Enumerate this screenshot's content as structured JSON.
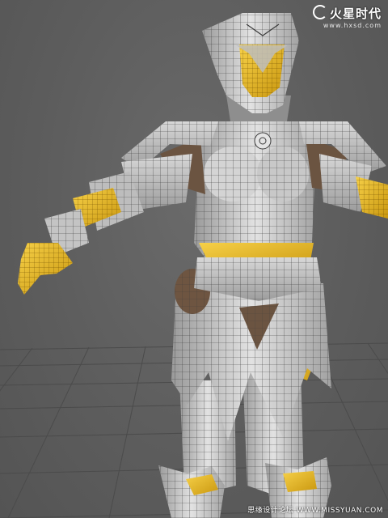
{
  "viewport": {
    "description_kind": "3D viewport render",
    "background_color": "#5f5f5f",
    "grid_color": "#4c4c4c"
  },
  "model": {
    "armor_color": "#c9c9c9",
    "wire_color": "#3a3a3a",
    "skin_color": "#e8b92a",
    "leather_color": "#6b5441"
  },
  "watermark_top": {
    "logo_text": "火星时代",
    "url": "www.hxsd.com"
  },
  "watermark_bottom": {
    "text": "思缘设计论坛 WWW.MISSYUAN.COM"
  }
}
